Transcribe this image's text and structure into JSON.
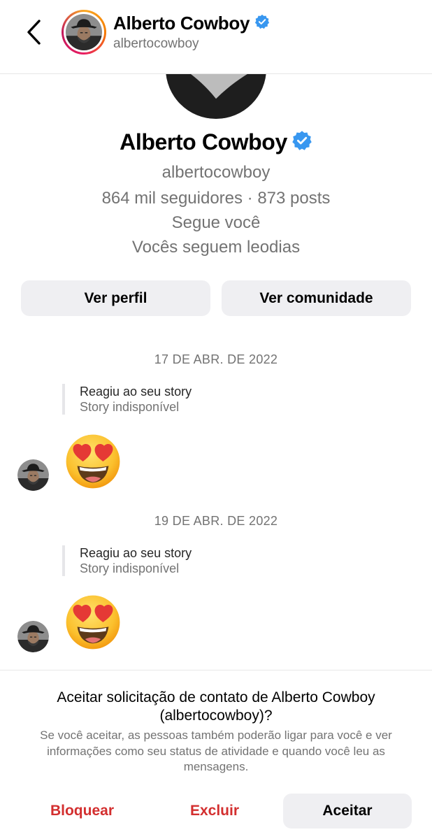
{
  "header": {
    "name": "Alberto Cowboy",
    "handle": "albertocowboy"
  },
  "profile": {
    "name": "Alberto Cowboy",
    "handle": "albertocowboy",
    "stats": "864 mil seguidores · 873 posts",
    "follows_you": "Segue você",
    "mutual": "Vocês seguem leodias"
  },
  "buttons": {
    "view_profile": "Ver perfil",
    "view_community": "Ver comunidade"
  },
  "messages": [
    {
      "date": "17 DE ABR. DE 2022",
      "reply_title": "Reagiu ao seu story",
      "reply_subtitle": "Story indisponível",
      "reaction": "heart-eyes-emoji"
    },
    {
      "date": "19 DE ABR. DE 2022",
      "reply_title": "Reagiu ao seu story",
      "reply_subtitle": "Story indisponível",
      "reaction": "heart-eyes-emoji"
    }
  ],
  "request": {
    "title": "Aceitar solicitação de contato de Alberto Cowboy (albertocowboy)?",
    "description": "Se você aceitar, as pessoas também poderão ligar para você e ver informações como seu status de atividade e quando você leu as mensagens.",
    "block_label": "Bloquear",
    "delete_label": "Excluir",
    "accept_label": "Aceitar"
  },
  "colors": {
    "verified": "#3897f0",
    "danger": "#d32f2f",
    "secondary_text": "#737373",
    "button_bg": "#efeff2"
  }
}
